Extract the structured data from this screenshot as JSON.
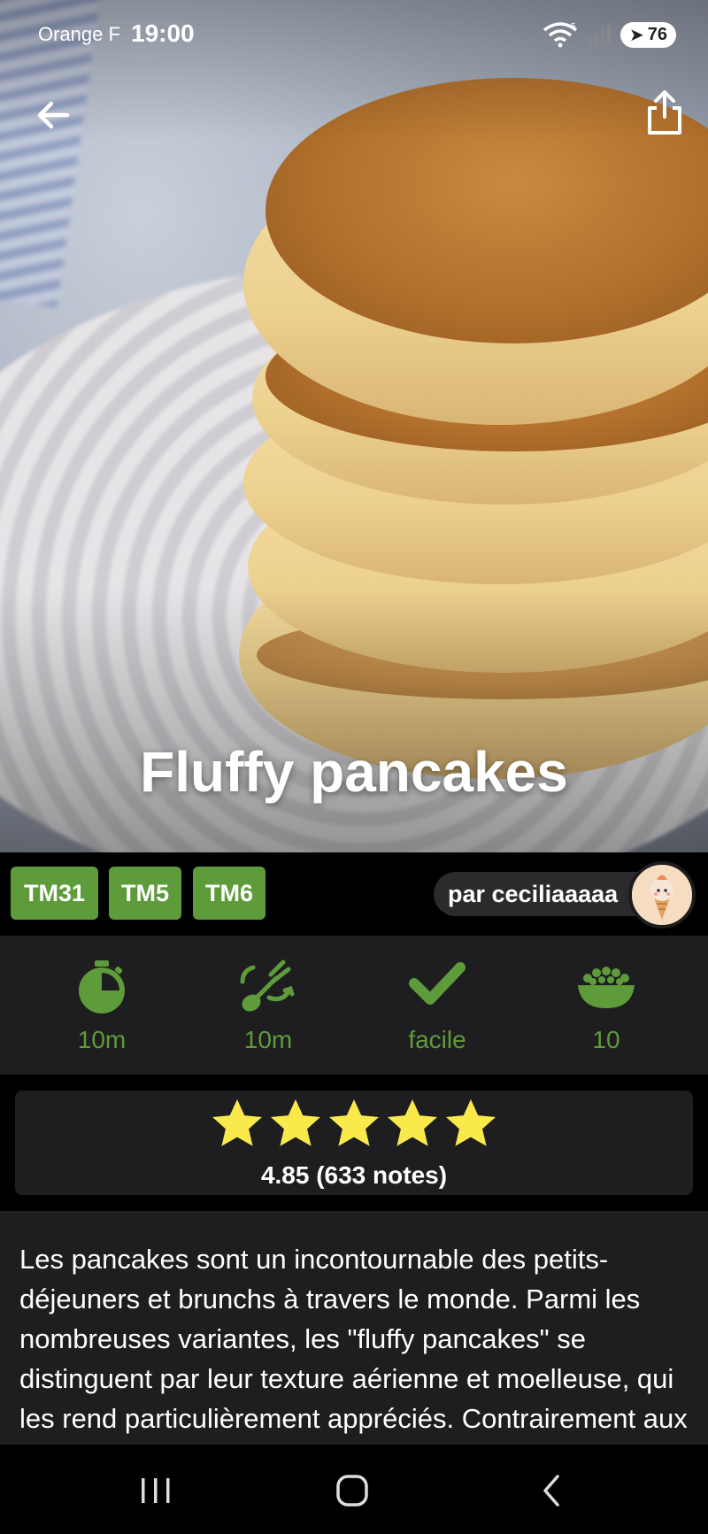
{
  "status_bar": {
    "carrier": "Orange F",
    "time": "19:00",
    "battery": "76",
    "wifi_badge": "5"
  },
  "recipe": {
    "title": "Fluffy pancakes",
    "tags": [
      "TM31",
      "TM5",
      "TM6"
    ],
    "author_label": "par ceciliaaaaa"
  },
  "stats": {
    "prep_time": "10m",
    "cook_time": "10m",
    "difficulty": "facile",
    "servings": "10"
  },
  "rating": {
    "stars": 5,
    "text": "4.85 (633 notes)"
  },
  "description": "Les pancakes sont un incontournable des petits-déjeuners et brunchs à travers le monde. Parmi les nombreuses variantes, les \"fluffy pancakes\" se distinguent par leur texture aérienne et moelleuse, qui les rend particulièrement appréciés. Contrairement aux pancakes américains",
  "icons": {
    "back": "arrow-left-icon",
    "share": "share-icon",
    "prep": "stopwatch-icon",
    "cook": "whisk-icon",
    "difficulty": "check-icon",
    "servings": "bowl-icon"
  },
  "colors": {
    "accent_green": "#5e9b3a",
    "star_yellow": "#fae94a",
    "panel": "#1e1e20"
  }
}
